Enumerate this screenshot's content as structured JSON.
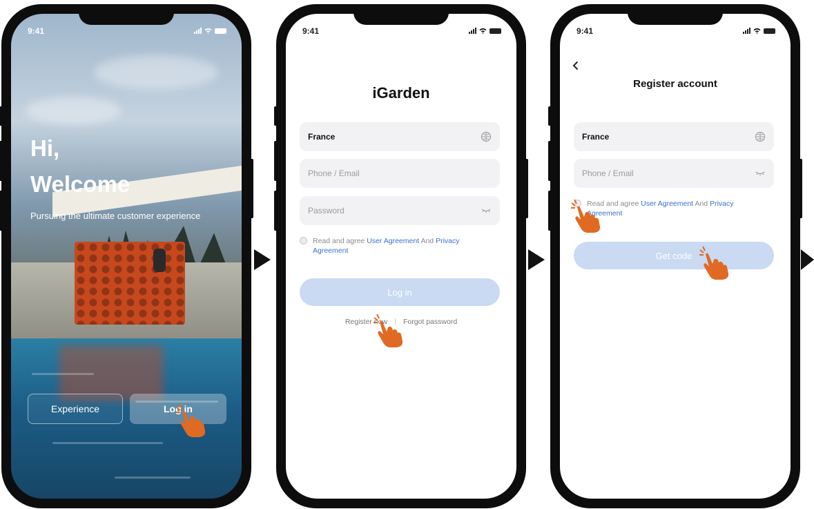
{
  "status_bar": {
    "time": "9:41"
  },
  "screen_welcome": {
    "greeting_line1": "Hi,",
    "greeting_line2": "Welcome",
    "tagline": "Pursuing the ultimate customer experience",
    "experience_button": "Experience",
    "login_button": "Log in"
  },
  "screen_login": {
    "app_title": "iGarden",
    "country": {
      "value": "France",
      "icon": "globe-icon"
    },
    "account_field": {
      "placeholder": "Phone / Email"
    },
    "password_field": {
      "placeholder": "Password",
      "icon": "eye-closed-icon"
    },
    "agreement": {
      "prefix": "Read and agree",
      "user_agreement": "User Agreement",
      "and": "And",
      "privacy_part1": "Privacy",
      "privacy_part2": "Agreement"
    },
    "login_button": "Log in",
    "register_link": "Register now",
    "forgot_link": "Forgot password"
  },
  "screen_register": {
    "back_icon": "chevron-left-icon",
    "title": "Register account",
    "country": {
      "value": "France",
      "icon": "globe-icon"
    },
    "account_field": {
      "placeholder": "Phone / Email"
    },
    "agreement": {
      "prefix": "Read and agree",
      "user_agreement": "User Agreement",
      "and": "And",
      "privacy_part1": "Privacy",
      "privacy_part2": "Agreement"
    },
    "get_code_button": "Get code"
  },
  "colors": {
    "accent": "#3a6fcf",
    "disabled_button": "#c9daf2",
    "hand": "#e06a24",
    "unit": "#c8481e"
  }
}
